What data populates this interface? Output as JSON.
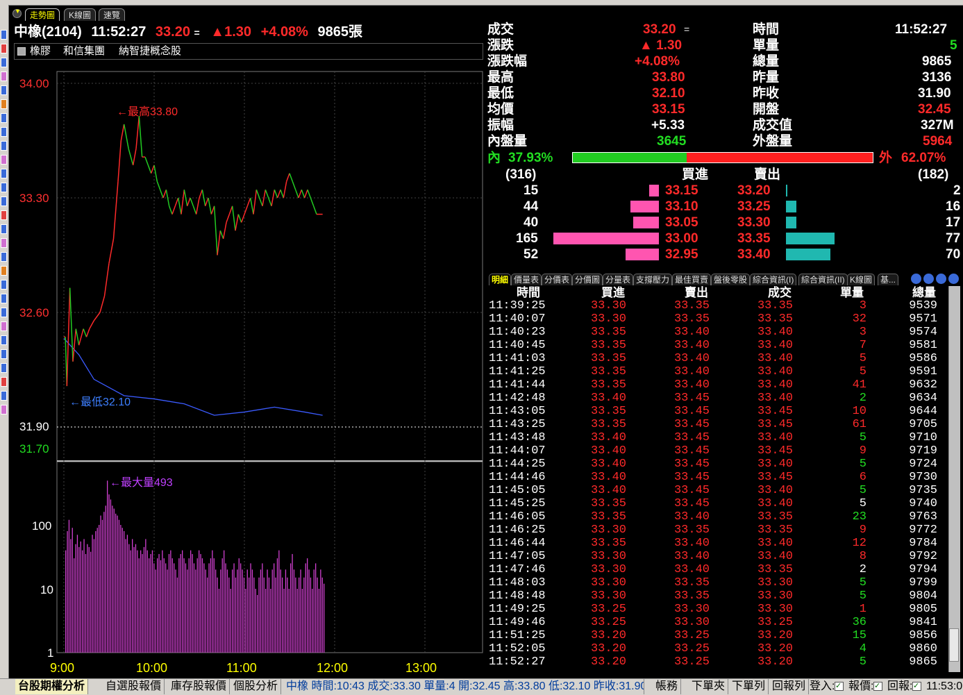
{
  "tabs": {
    "t1": "走勢圖",
    "t2": "K線圖",
    "t3": "速覽"
  },
  "header": {
    "name": "中橡(2104)",
    "time": "11:52:27",
    "price": "33.20",
    "eq": "=",
    "change": "▲1.30",
    "pct": "+4.08%",
    "volume": "9865張"
  },
  "tags": {
    "t1": "橡膠",
    "t2": "和信集團",
    "t3": "納智捷概念股"
  },
  "chart_labels": {
    "y1": "34.00",
    "y2": "33.30",
    "y3": "32.60",
    "y4": "31.90",
    "y5": "31.70",
    "v1": "100",
    "v2": "10",
    "v3": "1",
    "x1": "9:00",
    "x2": "10:00",
    "x3": "11:00",
    "x4": "12:00",
    "x5": "13:00",
    "high_note": "←最高33.80",
    "low_note": "←最低32.10",
    "vol_note": "←最大量493"
  },
  "quote": {
    "l1": "成交",
    "v1": "33.20",
    "v1s": "=",
    "l2": "漲跌",
    "v2": "▲ 1.30",
    "l3": "漲跌幅",
    "v3": "+4.08%",
    "l4": "最高",
    "v4": "33.80",
    "l5": "最低",
    "v5": "32.10",
    "l6": "均價",
    "v6": "33.15",
    "l7": "振幅",
    "v7": "+5.33",
    "l8": "內盤量",
    "v8": "3645",
    "r1": "時間",
    "w1": "11:52:27",
    "r2": "單量",
    "w2": "5",
    "r3": "總量",
    "w3": "9865",
    "r4": "昨量",
    "w4": "3136",
    "r5": "昨收",
    "w5": "31.90",
    "r6": "開盤",
    "w6": "32.45",
    "r7": "成交值",
    "w7": "327M",
    "r8": "外盤量",
    "w8": "5964"
  },
  "inout": {
    "in_label": "內",
    "in_pct": "37.93%",
    "in_frac": 0.3793,
    "out_label": "外",
    "out_pct": "62.07%"
  },
  "book": {
    "bid_total": "(316)",
    "bid_title": "買進",
    "ask_title": "賣出",
    "ask_total": "(182)",
    "rows": [
      {
        "bq": "15",
        "bp": "33.15",
        "ap": "33.20",
        "aq": "2",
        "bn": 15,
        "an": 2
      },
      {
        "bq": "44",
        "bp": "33.10",
        "ap": "33.25",
        "aq": "16",
        "bn": 44,
        "an": 16
      },
      {
        "bq": "40",
        "bp": "33.05",
        "ap": "33.30",
        "aq": "17",
        "bn": 40,
        "an": 17
      },
      {
        "bq": "165",
        "bp": "33.00",
        "ap": "33.35",
        "aq": "77",
        "bn": 165,
        "an": 77
      },
      {
        "bq": "52",
        "bp": "32.95",
        "ap": "33.40",
        "aq": "70",
        "bn": 52,
        "an": 70
      }
    ]
  },
  "detail_tabs": [
    "明細",
    "價量表",
    "分價表",
    "分價圖",
    "分量表",
    "支撐壓力",
    "最佳買賣",
    "盤後零股",
    "綜合資訊(I)",
    "綜合資訊(II)",
    "K線圖",
    "基..."
  ],
  "ticks_header": {
    "c1": "時間",
    "c2": "買進",
    "c3": "賣出",
    "c4": "成交",
    "c5": "單量",
    "c6": "總量"
  },
  "ticks": [
    [
      "11:39:25",
      "33.30",
      "33.35",
      "33.35",
      "3",
      "9539",
      "r"
    ],
    [
      "11:40:07",
      "33.30",
      "33.35",
      "33.35",
      "32",
      "9571",
      "r"
    ],
    [
      "11:40:23",
      "33.35",
      "33.40",
      "33.40",
      "3",
      "9574",
      "r"
    ],
    [
      "11:40:45",
      "33.35",
      "33.40",
      "33.40",
      "7",
      "9581",
      "r"
    ],
    [
      "11:41:03",
      "33.35",
      "33.40",
      "33.40",
      "5",
      "9586",
      "r"
    ],
    [
      "11:41:25",
      "33.35",
      "33.40",
      "33.40",
      "5",
      "9591",
      "r"
    ],
    [
      "11:41:44",
      "33.35",
      "33.40",
      "33.40",
      "41",
      "9632",
      "r"
    ],
    [
      "11:42:48",
      "33.40",
      "33.45",
      "33.40",
      "2",
      "9634",
      "g"
    ],
    [
      "11:43:05",
      "33.35",
      "33.45",
      "33.45",
      "10",
      "9644",
      "r"
    ],
    [
      "11:43:25",
      "33.35",
      "33.45",
      "33.45",
      "61",
      "9705",
      "r"
    ],
    [
      "11:43:48",
      "33.40",
      "33.45",
      "33.40",
      "5",
      "9710",
      "g"
    ],
    [
      "11:44:07",
      "33.40",
      "33.45",
      "33.45",
      "9",
      "9719",
      "r"
    ],
    [
      "11:44:25",
      "33.40",
      "33.45",
      "33.40",
      "5",
      "9724",
      "g"
    ],
    [
      "11:44:46",
      "33.40",
      "33.45",
      "33.45",
      "6",
      "9730",
      "r"
    ],
    [
      "11:45:05",
      "33.40",
      "33.45",
      "33.40",
      "5",
      "9735",
      "g"
    ],
    [
      "11:45:25",
      "33.35",
      "33.45",
      "33.40",
      "5",
      "9740",
      "w"
    ],
    [
      "11:46:05",
      "33.35",
      "33.40",
      "33.35",
      "23",
      "9763",
      "g"
    ],
    [
      "11:46:25",
      "33.30",
      "33.35",
      "33.35",
      "9",
      "9772",
      "r"
    ],
    [
      "11:46:44",
      "33.35",
      "33.40",
      "33.40",
      "12",
      "9784",
      "r"
    ],
    [
      "11:47:05",
      "33.30",
      "33.40",
      "33.40",
      "8",
      "9792",
      "r"
    ],
    [
      "11:47:46",
      "33.30",
      "33.40",
      "33.35",
      "2",
      "9794",
      "w"
    ],
    [
      "11:48:03",
      "33.30",
      "33.35",
      "33.30",
      "5",
      "9799",
      "g"
    ],
    [
      "11:48:48",
      "33.30",
      "33.35",
      "33.30",
      "5",
      "9804",
      "g"
    ],
    [
      "11:49:25",
      "33.25",
      "33.30",
      "33.30",
      "1",
      "9805",
      "r"
    ],
    [
      "11:49:46",
      "33.25",
      "33.30",
      "33.25",
      "36",
      "9841",
      "g"
    ],
    [
      "11:51:25",
      "33.20",
      "33.25",
      "33.20",
      "15",
      "9856",
      "g"
    ],
    [
      "11:52:05",
      "33.20",
      "33.25",
      "33.20",
      "4",
      "9860",
      "g"
    ],
    [
      "11:52:27",
      "33.20",
      "33.25",
      "33.20",
      "5",
      "9865",
      "g"
    ]
  ],
  "bottom": {
    "b1": "台股期權分析",
    "b2": "自選股報價",
    "b3": "庫存股報價",
    "b4": "個股分析",
    "ticker": "中橡 時間:10:43 成交:33.30 單量:4 開:32.45 高:33.80 低:32.10 昨收:31.90 總量",
    "b5": "帳務",
    "b6": "下單夾",
    "b7": "下單列",
    "b8": "回報列",
    "b9": "登入:",
    "b10": "報價:",
    "b11": "回報:",
    "b12": "11:53:0"
  },
  "chart_data": {
    "type": "line",
    "title": "",
    "x_ticks": [
      "9:00",
      "10:00",
      "11:00",
      "12:00",
      "13:00"
    ],
    "y_ticks": [
      34.0,
      33.3,
      32.6,
      31.9,
      31.7
    ],
    "ylim": [
      31.7,
      34.0
    ],
    "prev_close": 31.9,
    "high": 33.8,
    "low": 32.1,
    "series": [
      {
        "name": "price",
        "x": [
          0,
          1,
          2,
          4,
          6,
          8,
          10,
          13,
          15,
          17,
          20,
          24,
          27,
          30,
          33,
          36,
          38,
          40,
          43,
          46,
          48,
          50,
          52,
          54,
          56,
          58,
          60,
          62,
          64,
          66,
          68,
          70,
          72,
          74,
          76,
          78,
          80,
          82,
          84,
          86,
          88,
          90,
          92,
          94,
          96,
          98,
          100,
          102,
          104,
          106,
          108,
          110,
          112,
          114,
          116,
          118,
          120,
          122,
          124,
          126,
          128,
          130,
          132,
          134,
          136,
          138,
          140,
          142,
          144,
          146,
          148,
          150,
          152,
          154,
          156,
          158,
          160,
          162,
          164,
          166,
          168,
          172
        ],
        "y": [
          32.45,
          32.45,
          32.15,
          32.75,
          32.3,
          32.5,
          32.4,
          32.5,
          32.45,
          32.5,
          32.55,
          32.6,
          32.7,
          32.9,
          33.05,
          33.4,
          33.65,
          33.75,
          33.6,
          33.5,
          33.6,
          33.8,
          33.55,
          33.55,
          33.5,
          33.45,
          33.5,
          33.4,
          33.35,
          33.3,
          33.35,
          33.25,
          33.2,
          33.25,
          33.3,
          33.2,
          33.35,
          33.25,
          33.3,
          33.25,
          33.2,
          33.3,
          33.35,
          33.25,
          33.3,
          33.2,
          33.25,
          32.95,
          33.1,
          33.05,
          33.15,
          33.2,
          33.25,
          33.1,
          33.2,
          33.15,
          33.2,
          33.25,
          33.3,
          33.2,
          33.35,
          33.3,
          33.25,
          33.35,
          33.3,
          33.25,
          33.35,
          33.3,
          33.35,
          33.3,
          33.4,
          33.45,
          33.4,
          33.35,
          33.3,
          33.35,
          33.3,
          33.35,
          33.3,
          33.25,
          33.2,
          33.2
        ]
      },
      {
        "name": "avg",
        "x": [
          0,
          10,
          20,
          30,
          40,
          60,
          80,
          100,
          120,
          140,
          160,
          172
        ],
        "y": [
          32.45,
          32.35,
          32.2,
          32.15,
          32.1,
          32.08,
          32.05,
          31.98,
          32.0,
          32.03,
          32.0,
          31.98
        ]
      },
      {
        "name": "volume",
        "x_desc": "per-minute, log scale 1..493",
        "values": [
          40,
          80,
          120,
          60,
          90,
          30,
          50,
          70,
          45,
          55,
          40,
          60,
          35,
          50,
          45,
          38,
          70,
          60,
          80,
          90,
          100,
          140,
          120,
          160,
          200,
          493,
          300,
          250,
          200,
          180,
          150,
          140,
          120,
          100,
          90,
          80,
          60,
          70,
          50,
          40,
          60,
          45,
          50,
          40,
          30,
          40,
          35,
          45,
          60,
          40,
          30,
          35,
          40,
          25,
          20,
          30,
          35,
          28,
          40,
          30,
          25,
          20,
          35,
          40,
          30,
          25,
          20,
          15,
          30,
          35,
          40,
          30,
          25,
          20,
          30,
          40,
          35,
          25,
          20,
          30,
          40,
          35,
          30,
          25,
          20,
          15,
          25,
          30,
          40,
          30,
          20,
          15,
          10,
          20,
          30,
          40,
          25,
          20,
          15,
          10,
          20,
          25,
          15,
          20,
          30,
          25,
          20,
          15,
          10,
          20,
          15,
          25,
          20,
          15,
          10,
          8,
          15,
          20,
          25,
          15,
          10,
          20,
          15,
          10,
          20,
          25,
          15,
          30,
          40,
          20,
          15,
          10,
          20,
          15,
          10,
          25,
          35,
          20,
          15,
          10,
          15,
          20,
          10,
          15,
          25,
          30,
          20,
          15,
          10,
          20,
          25,
          15,
          10,
          20,
          15,
          12
        ]
      }
    ]
  }
}
